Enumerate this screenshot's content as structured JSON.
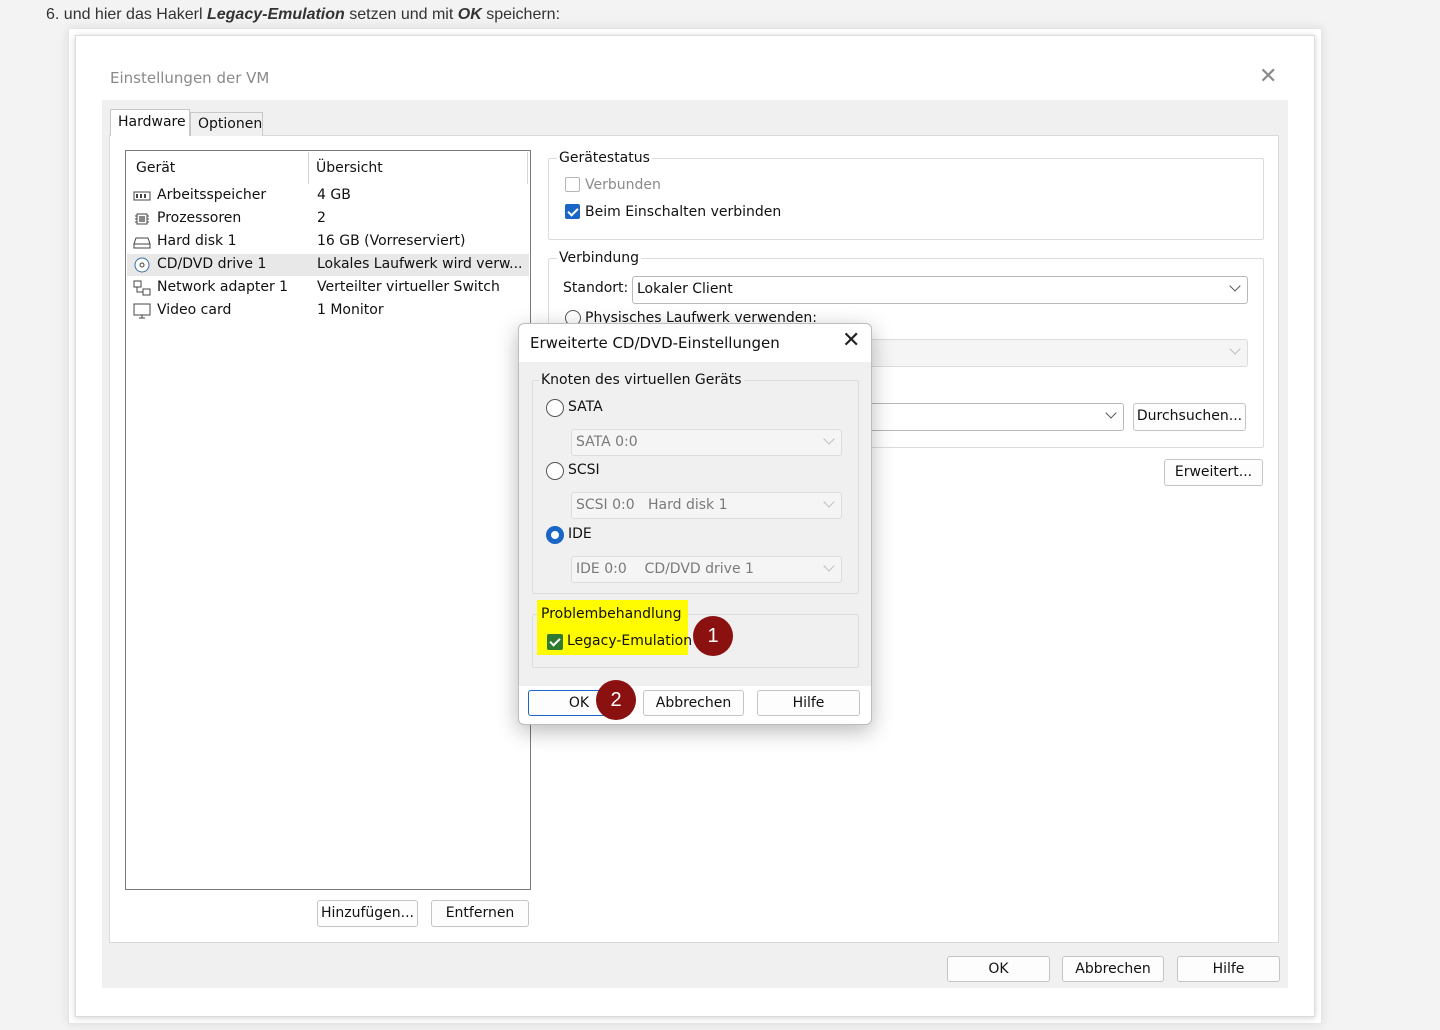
{
  "intro": {
    "prefix": "6. und hier das Hakerl ",
    "bold1": "Legacy-Emulation",
    "middle": " setzen und mit ",
    "bold2": "OK",
    "suffix": " speichern:"
  },
  "window": {
    "title": "Einstellungen der VM",
    "close_glyph": "✕",
    "tabs": [
      {
        "label": "Hardware",
        "active": true
      },
      {
        "label": "Optionen",
        "active": false
      }
    ]
  },
  "device_list": {
    "headers": [
      "Gerät",
      "Übersicht"
    ],
    "rows": [
      {
        "icon": "memory-icon",
        "name": "Arbeitsspeicher",
        "summary": "4 GB",
        "selected": false
      },
      {
        "icon": "cpu-icon",
        "name": "Prozessoren",
        "summary": "2",
        "selected": false
      },
      {
        "icon": "hard-disk-icon",
        "name": "Hard disk 1",
        "summary": "16 GB (Vorreserviert)",
        "selected": false
      },
      {
        "icon": "cd-dvd-icon",
        "name": "CD/DVD drive 1",
        "summary": "Lokales Laufwerk  wird verw...",
        "selected": true
      },
      {
        "icon": "network-icon",
        "name": "Network adapter 1",
        "summary": "Verteilter virtueller Switch",
        "selected": false
      },
      {
        "icon": "monitor-icon",
        "name": "Video card",
        "summary": "1 Monitor",
        "selected": false
      }
    ],
    "add_label": "Hinzufügen...",
    "remove_label": "Entfernen"
  },
  "device_status": {
    "title": "Gerätestatus",
    "connected_label": "Verbunden",
    "connected": false,
    "connect_on_power_label": "Beim Einschalten verbinden",
    "connect_on_power": true
  },
  "connection": {
    "title": "Verbindung",
    "location_label": "Standort:",
    "location_value": "Lokaler Client",
    "physical_drive_label": "Physisches Laufwerk verwenden:",
    "image_value": ")",
    "browse_label": "Durchsuchen...",
    "advanced_label": "Erweitert..."
  },
  "footer": {
    "ok": "OK",
    "cancel": "Abbrechen",
    "help": "Hilfe"
  },
  "dialog": {
    "title": "Erweiterte CD/DVD-Einstellungen",
    "close_glyph": "✕",
    "node_group_title": "Knoten des virtuellen Geräts",
    "options": [
      {
        "label": "SATA",
        "selected": false,
        "combo": "SATA 0:0"
      },
      {
        "label": "SCSI",
        "selected": false,
        "combo": "SCSI 0:0   Hard disk 1"
      },
      {
        "label": "IDE",
        "selected": true,
        "combo": "IDE 0:0    CD/DVD drive 1"
      }
    ],
    "trouble_title": "Problembehandlung",
    "legacy_label": "Legacy-Emulation",
    "legacy_checked": true,
    "ok": "OK",
    "cancel": "Abbrechen",
    "help": "Hilfe",
    "highlight_color": "#fffb00"
  },
  "markers": [
    "1",
    "2"
  ],
  "colors": {
    "accent": "#1a66c7",
    "marker": "#8b1010",
    "checkbox_green": "#2f7a2f"
  }
}
